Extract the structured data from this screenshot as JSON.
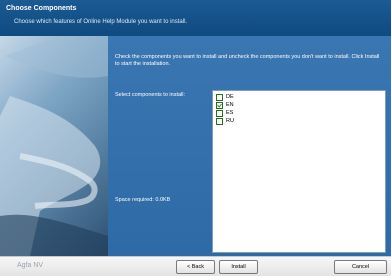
{
  "header": {
    "title": "Choose Components",
    "subtitle": "Choose which features of Online Help Module you want to install."
  },
  "main": {
    "instructions": "Check the components you want to install and uncheck the components you don't want to install. Click Install to start the installation.",
    "select_label": "Select components to install:",
    "space_required": "Space required: 0.0KB",
    "components": [
      {
        "label": "DE",
        "checked": false
      },
      {
        "label": "EN",
        "checked": true
      },
      {
        "label": "ES",
        "checked": false
      },
      {
        "label": "RU",
        "checked": false
      }
    ]
  },
  "footer": {
    "brand": "Agfa NV",
    "back_label": "< Back",
    "install_label": "Install",
    "cancel_label": "Cancel"
  },
  "colors": {
    "header": "#1b5a93",
    "panel": "#2e6aa6"
  }
}
